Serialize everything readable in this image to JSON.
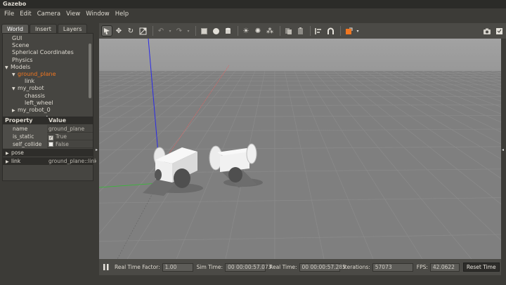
{
  "window": {
    "title": "Gazebo"
  },
  "menu": [
    "File",
    "Edit",
    "Camera",
    "View",
    "Window",
    "Help"
  ],
  "tabs": [
    "World",
    "Insert",
    "Layers"
  ],
  "tree": {
    "items": [
      {
        "label": "GUI",
        "indent": 0,
        "arrow": ""
      },
      {
        "label": "Scene",
        "indent": 0,
        "arrow": ""
      },
      {
        "label": "Spherical Coordinates",
        "indent": 0,
        "arrow": ""
      },
      {
        "label": "Physics",
        "indent": 0,
        "arrow": ""
      },
      {
        "label": "Models",
        "indent": 0,
        "arrow": "down"
      },
      {
        "label": "ground_plane",
        "indent": 1,
        "arrow": "down",
        "selected": true
      },
      {
        "label": "link",
        "indent": 2,
        "arrow": ""
      },
      {
        "label": "my_robot",
        "indent": 1,
        "arrow": "down"
      },
      {
        "label": "chassis",
        "indent": 2,
        "arrow": ""
      },
      {
        "label": "left_wheel",
        "indent": 2,
        "arrow": ""
      },
      {
        "label": "my_robot_0",
        "indent": 1,
        "arrow": "right"
      }
    ]
  },
  "properties": {
    "header_property": "Property",
    "header_value": "Value",
    "name_key": "name",
    "name_value": "ground_plane",
    "is_static_key": "is_static",
    "is_static_value": "True",
    "self_collide_key": "self_collide",
    "self_collide_value": "False",
    "pose_label": "pose",
    "link_label": "link",
    "link_value": "ground_plane::link"
  },
  "bottom": {
    "rtf_label": "Real Time Factor:",
    "rtf_value": "1.00",
    "sim_label": "Sim Time:",
    "sim_value": "00 00:00:57.073",
    "real_label": "Real Time:",
    "real_value": "00 00:00:57.285",
    "iter_label": "Iterations:",
    "iter_value": "57073",
    "fps_label": "FPS:",
    "fps_value": "42.0622",
    "reset_label": "Reset Time"
  },
  "colors": {
    "accent": "#f07620",
    "sky": "#9d9d9d",
    "ground": "#7f7f7f"
  }
}
